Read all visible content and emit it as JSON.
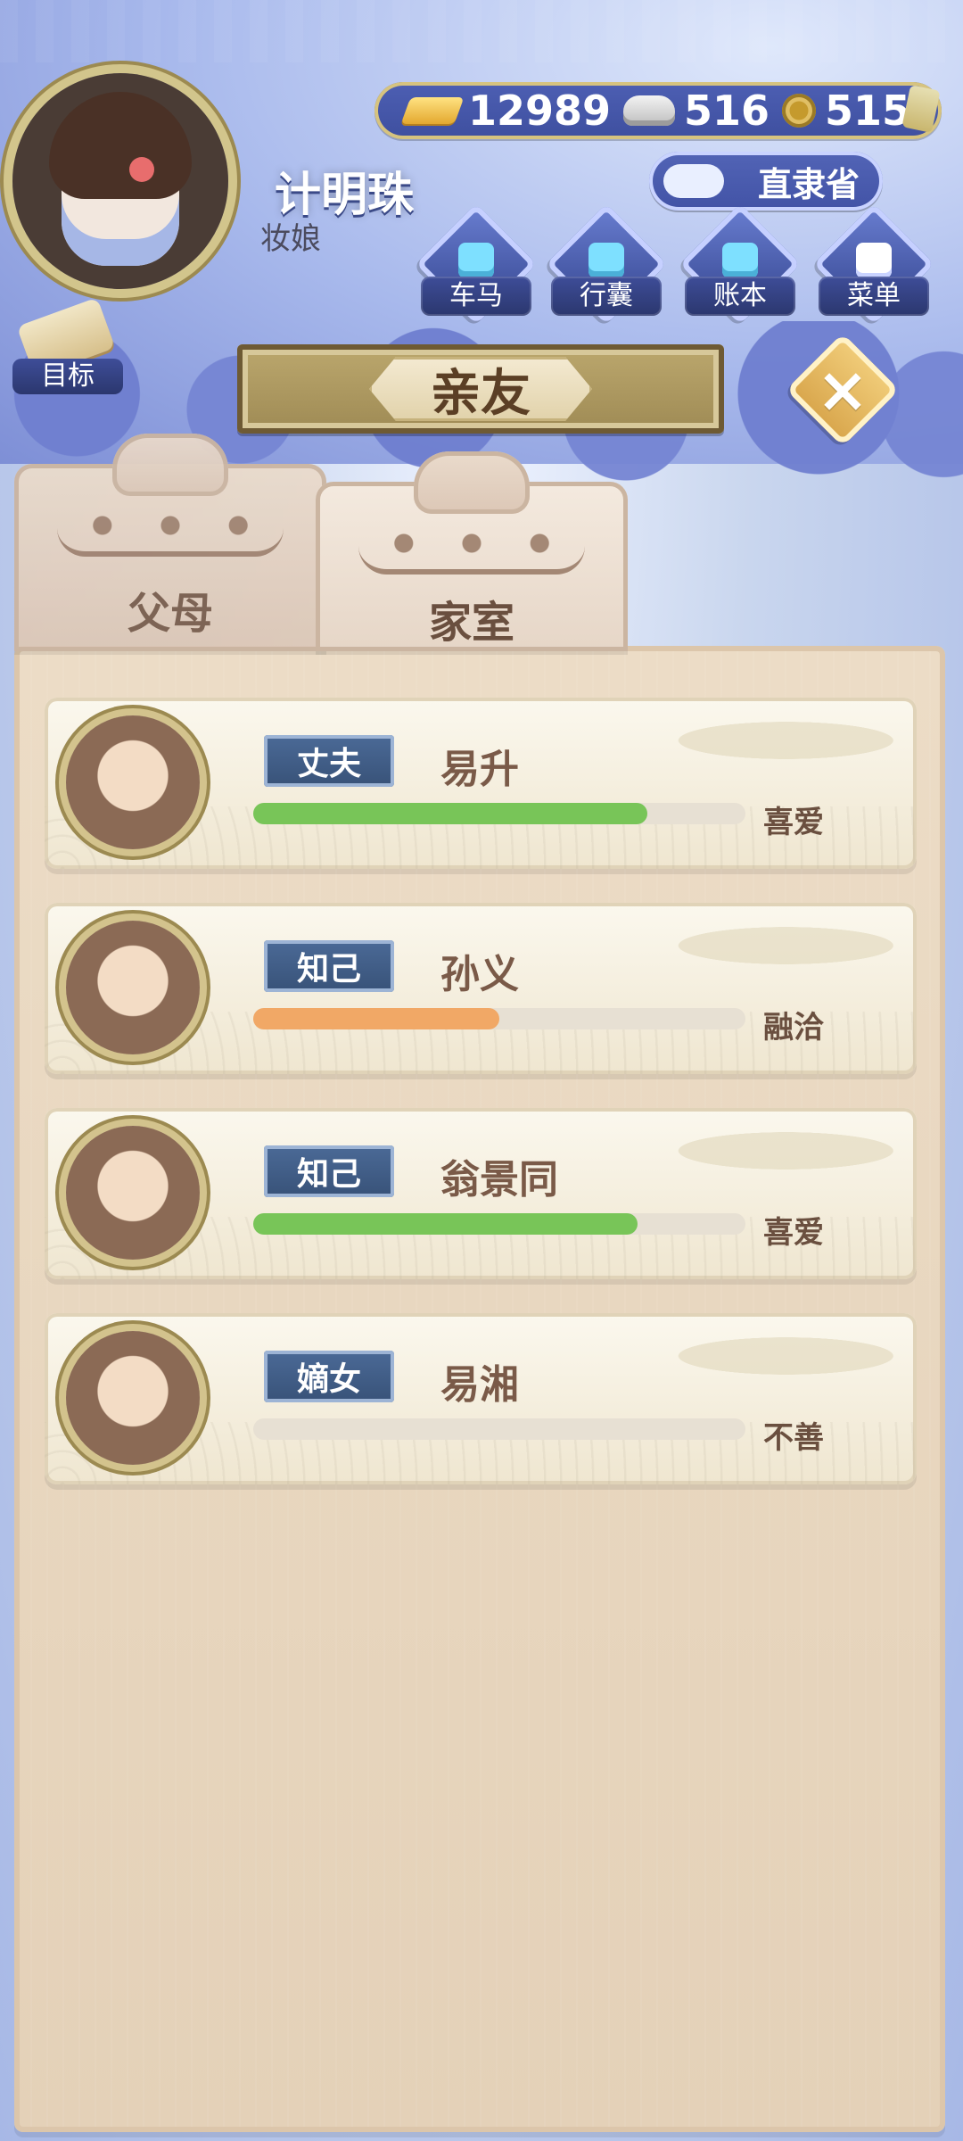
{
  "player": {
    "name": "计明珠",
    "title": "妆娘"
  },
  "resources": {
    "gold": "12989",
    "silver": "516",
    "coins": "515"
  },
  "location": "直隶省",
  "menu": [
    {
      "label": "车马",
      "icon": "carriage-icon"
    },
    {
      "label": "行囊",
      "icon": "bag-icon"
    },
    {
      "label": "账本",
      "icon": "ledger-icon"
    },
    {
      "label": "菜单",
      "icon": "more-icon"
    }
  ],
  "goal_label": "目标",
  "page_title": "亲友",
  "tabs": [
    {
      "label": "父母",
      "selected": false
    },
    {
      "label": "家室",
      "selected": true
    }
  ],
  "relations": [
    {
      "tag": "丈夫",
      "name": "易升",
      "status": "喜爱",
      "affinity": 0.8,
      "color": "#78c558"
    },
    {
      "tag": "知己",
      "name": "孙义",
      "status": "融洽",
      "affinity": 0.5,
      "color": "#f1a866"
    },
    {
      "tag": "知己",
      "name": "翁景同",
      "status": "喜爱",
      "affinity": 0.78,
      "color": "#78c558"
    },
    {
      "tag": "嫡女",
      "name": "易湘",
      "status": "不善",
      "affinity": 0.0,
      "color": "#e7e0d3"
    }
  ]
}
